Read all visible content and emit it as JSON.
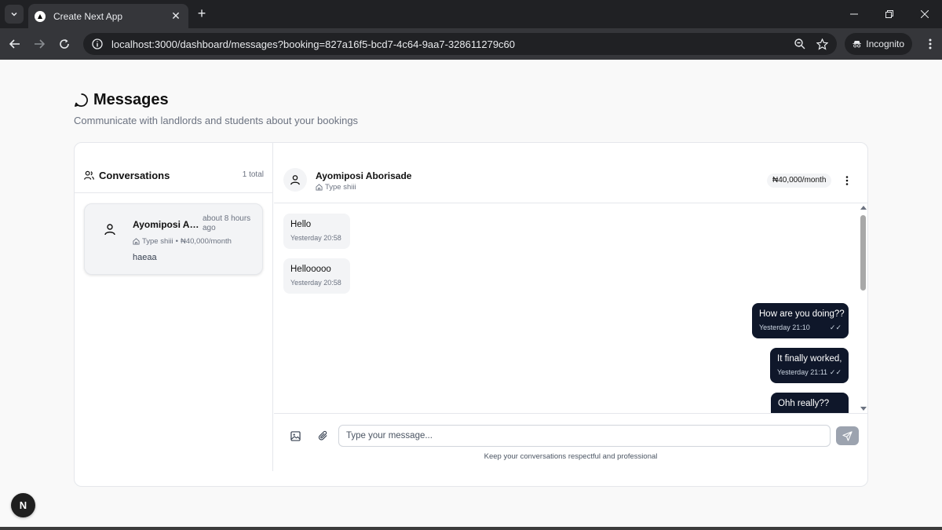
{
  "browser": {
    "tab_title": "Create Next App",
    "url": "localhost:3000/dashboard/messages?booking=827a16f5-bcd7-4c64-9aa7-328611279c60",
    "profile_label": "Incognito"
  },
  "page": {
    "title": "Messages",
    "subtitle": "Communicate with landlords and students about your bookings"
  },
  "sidebar": {
    "title": "Conversations",
    "count": "1 total",
    "conversations": [
      {
        "name": "Ayomiposi Abo...",
        "time": "about 8 hours ago",
        "property": "Type shiii",
        "price": "₦40,000/month",
        "preview": "haeaa"
      }
    ]
  },
  "chat": {
    "name": "Ayomiposi Aborisade",
    "property": "Type shiii",
    "price_badge": "₦40,000/month",
    "messages": [
      {
        "direction": "in",
        "text": "Hello",
        "time": "Yesterday 20:58"
      },
      {
        "direction": "in",
        "text": "Hellooooo",
        "time": "Yesterday 20:58"
      },
      {
        "direction": "out",
        "text": "How are you doing??",
        "time": "Yesterday 21:10",
        "status": "✓✓"
      },
      {
        "direction": "out",
        "text": "It finally worked,",
        "time": "Yesterday 21:11",
        "status": "✓✓"
      },
      {
        "direction": "out",
        "text": "Ohh really??",
        "time": "",
        "status": ""
      }
    ],
    "composer": {
      "placeholder": "Type your message...",
      "note": "Keep your conversations respectful and professional"
    }
  },
  "dev_badge": "N",
  "colors": {
    "outgoing_bubble": "#0f172a",
    "incoming_bubble": "#f3f4f6",
    "send_button": "#9ca3af"
  }
}
